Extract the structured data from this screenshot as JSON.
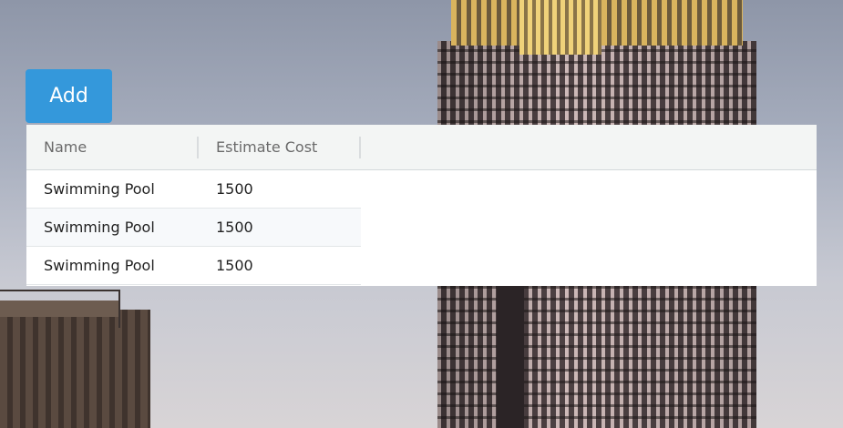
{
  "toolbar": {
    "add_label": "Add"
  },
  "grid": {
    "columns": [
      "Name",
      "Estimate Cost"
    ],
    "rows": [
      {
        "name": "Swimming Pool",
        "estimate_cost": "1500"
      },
      {
        "name": "Swimming Pool",
        "estimate_cost": "1500"
      },
      {
        "name": "Swimming Pool",
        "estimate_cost": "1500"
      }
    ]
  },
  "colors": {
    "add_button": "#3498db",
    "header_background": "#f3f5f4",
    "grid_background": "#ffffff"
  }
}
